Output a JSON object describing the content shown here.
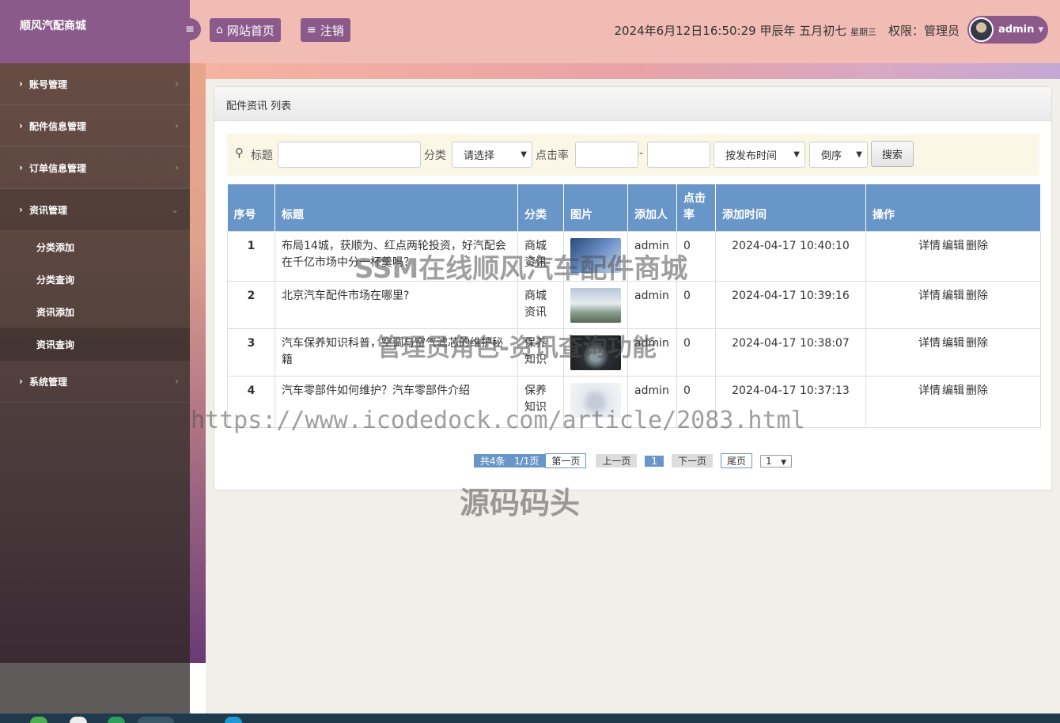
{
  "brand": "顺风汽配商城",
  "sidebar": {
    "items": [
      {
        "label": "账号管理"
      },
      {
        "label": "配件信息管理"
      },
      {
        "label": "订单信息管理"
      },
      {
        "label": "资讯管理"
      },
      {
        "label": "系统管理"
      }
    ],
    "sub_items": [
      "分类添加",
      "分类查询",
      "资讯添加",
      "资讯查询"
    ]
  },
  "header": {
    "home_label": "网站首页",
    "logout_label": "注销",
    "datetime": "2024年6月12日16:50:29 甲辰年 五月初七",
    "weekday": "星期三",
    "permission": "权限：管理员",
    "username": "admin"
  },
  "panel": {
    "title": "配件资讯 列表"
  },
  "search": {
    "title_label": "标题",
    "category_label": "分类",
    "category_value": "请选择",
    "clicks_label": "点击率",
    "range_sep": "-",
    "sort_value": "按发布时间",
    "order_value": "倒序",
    "button_label": "搜索"
  },
  "table": {
    "columns": [
      "序号",
      "标题",
      "分类",
      "图片",
      "添加人",
      "点击率",
      "添加时间",
      "操作"
    ],
    "rows": [
      {
        "no": "1",
        "title": "布局14城，获顺为、红点两轮投资，好汽配会在千亿市场中分一杯羹吗？",
        "category": "商城资讯",
        "author": "admin",
        "clicks": "0",
        "time": "2024-04-17 10:40:10"
      },
      {
        "no": "2",
        "title": "北京汽车配件市场在哪里?",
        "category": "商城资讯",
        "author": "admin",
        "clicks": "0",
        "time": "2024-04-17 10:39:16"
      },
      {
        "no": "3",
        "title": "汽车保养知识科普，空调与空气滤芯的维护秘籍",
        "category": "保养知识",
        "author": "admin",
        "clicks": "0",
        "time": "2024-04-17 10:38:07"
      },
      {
        "no": "4",
        "title": "汽车零部件如何维护？汽车零部件介绍",
        "category": "保养知识",
        "author": "admin",
        "clicks": "0",
        "time": "2024-04-17 10:37:13"
      }
    ],
    "ops": [
      "详情",
      "编辑",
      "删除"
    ]
  },
  "pager": {
    "total": "共4条",
    "pages": "1/1页",
    "first": "第一页",
    "prev": "上一页",
    "current": "1",
    "next": "下一页",
    "last": "尾页",
    "select": "1"
  },
  "watermarks": {
    "line1": "SSM在线顺风汽车配件商城",
    "line2": "管理员角色-资讯查询功能",
    "line3": "https://www.icodedock.com/article/2083.html",
    "line4": "源码码头"
  },
  "colors": {
    "header_bg": "#f0bcb3",
    "accent": "#8b5a8a",
    "table_header": "#6996c9",
    "search_bg": "#fbf7e6"
  }
}
